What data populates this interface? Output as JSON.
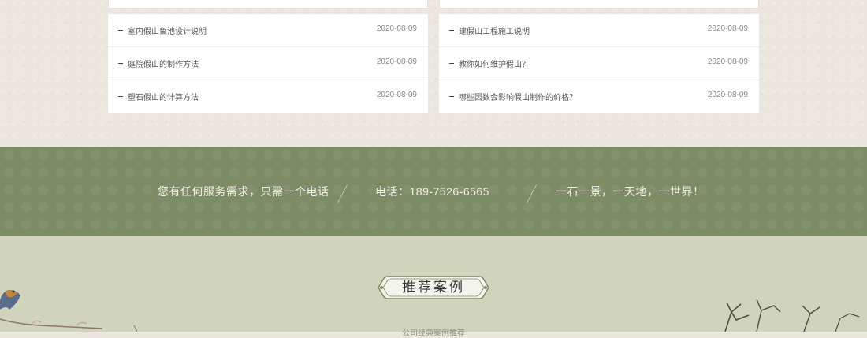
{
  "news": {
    "left": [
      {
        "title": "室内假山鱼池设计说明",
        "date": "2020-08-09"
      },
      {
        "title": "庭院假山的制作方法",
        "date": "2020-08-09"
      },
      {
        "title": "塑石假山的计算方法",
        "date": "2020-08-09"
      }
    ],
    "right": [
      {
        "title": "建假山工程施工说明",
        "date": "2020-08-09"
      },
      {
        "title": "教你如何维护假山？",
        "date": "2020-08-09"
      },
      {
        "title": "哪些因数会影响假山制作的价格？",
        "date": "2020-08-09"
      }
    ]
  },
  "contact": {
    "service_text": "您有任何服务需求，只需一个电话",
    "phone_text": "电话：189-7526-6565",
    "slogan": "一石一景，一天地，一世界！"
  },
  "recommend": {
    "title": "推荐案例",
    "subtitle": "公司经典案例推荐"
  },
  "colors": {
    "band_green": "#7c8c64",
    "recommend_bg": "#d0d4bc",
    "page_beige": "#ebe7df"
  }
}
